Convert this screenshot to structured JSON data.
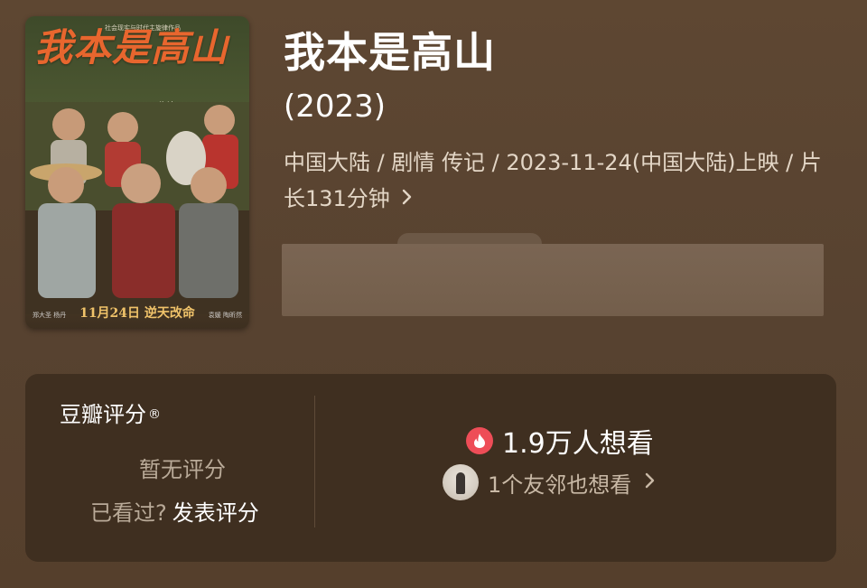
{
  "poster": {
    "headline": "我本是高山",
    "tagline": "社会现实与时代主旋律作品",
    "credit": "海清",
    "release": "11月24日 逆天改命",
    "small_left": "郑大圣 杨丹",
    "small_right": "袁媛 陶昕然"
  },
  "movie": {
    "title": "我本是高山",
    "year": "(2023)",
    "meta": "中国大陆 / 剧情 传记 / 2023-11-24(中国大陆)上映 / 片长131分钟"
  },
  "rating": {
    "title": "豆瓣评分",
    "registered": "®",
    "no_score": "暂无评分",
    "seen_question": "已看过?",
    "post_rating": "发表评分"
  },
  "wishlist": {
    "count_text": "1.9万人想看",
    "friends_text": "1个友邻也想看"
  },
  "icons": {
    "fire": "fire-icon",
    "chevron": "chevron-right-icon",
    "avatar": "avatar"
  },
  "colors": {
    "background": "#5b4530",
    "card": "#3f2f20",
    "accent_red": "#ee4d57",
    "poster_title": "#e8662e"
  }
}
